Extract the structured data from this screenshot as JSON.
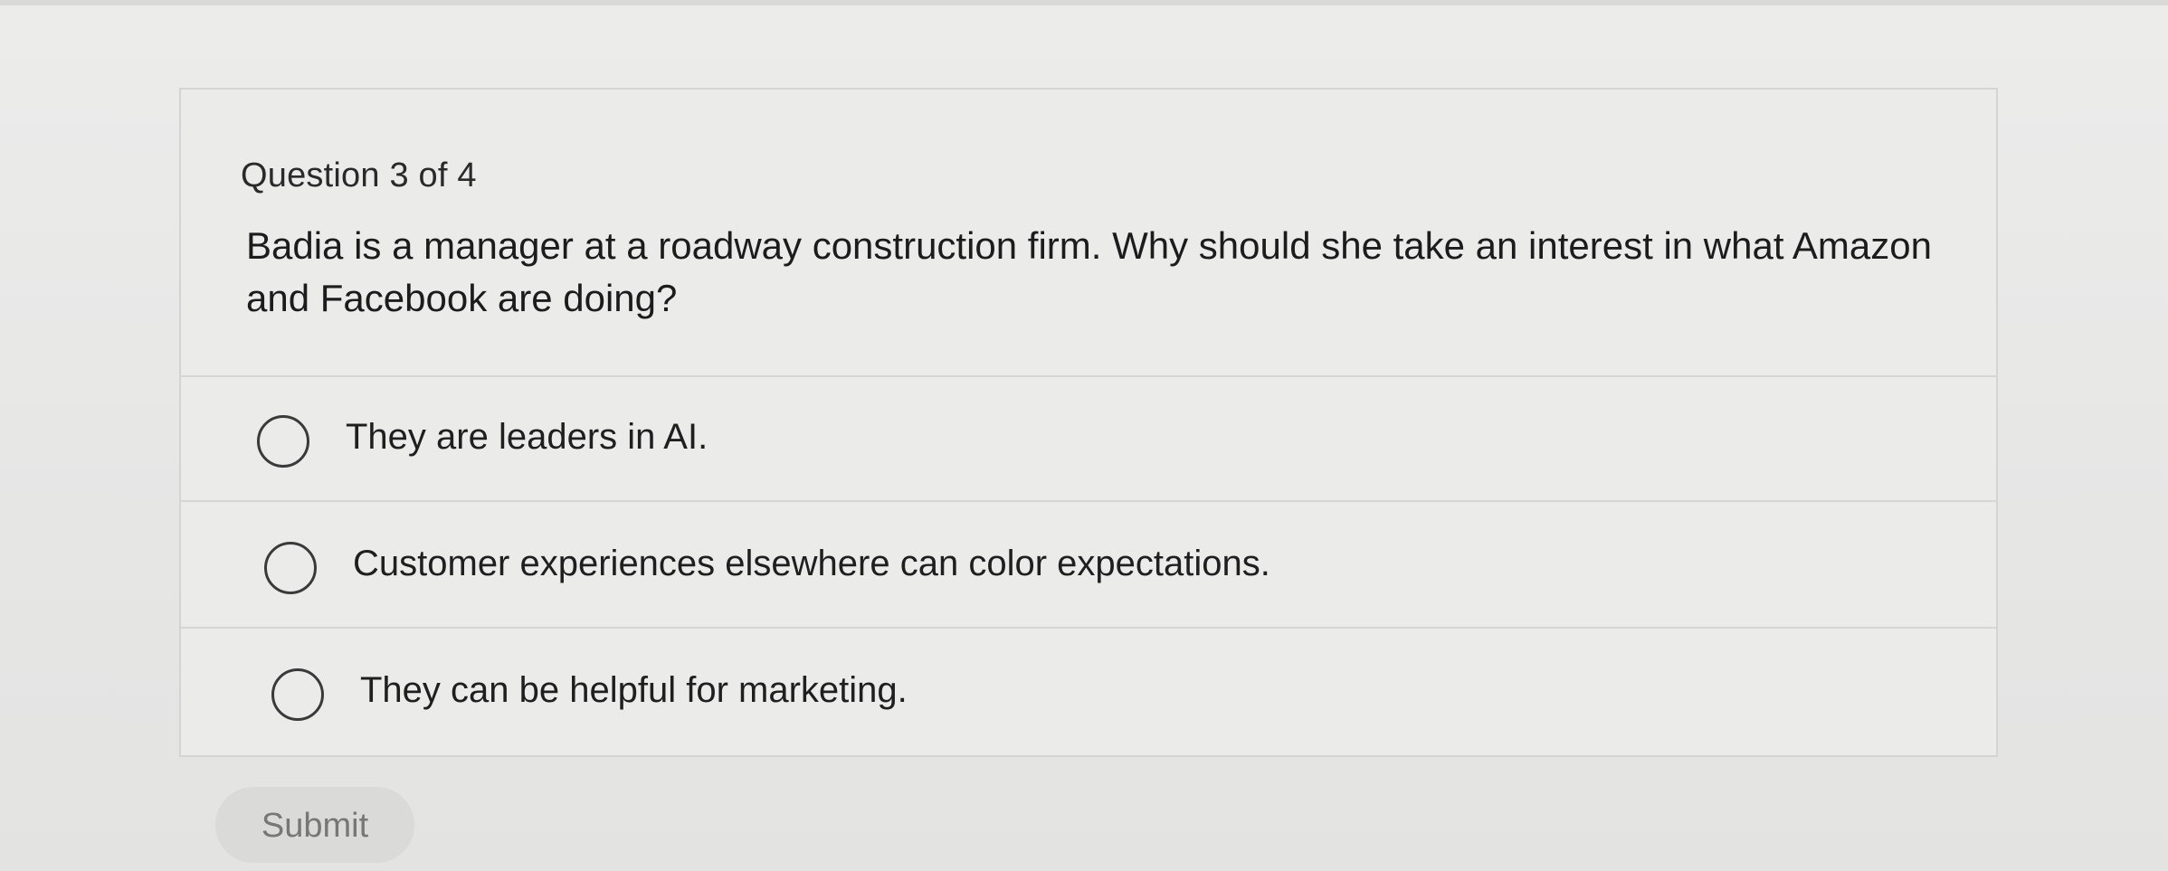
{
  "quiz": {
    "counter": "Question 3 of 4",
    "question": "Badia is a manager at a roadway construction firm. Why should she take an interest in what Amazon and Facebook are doing?",
    "options": [
      {
        "label": "They are leaders in AI.",
        "selected": false
      },
      {
        "label": "Customer experiences elsewhere can color expectations.",
        "selected": false
      },
      {
        "label": "They can be helpful for marketing.",
        "selected": false
      }
    ],
    "submit_label": "Submit",
    "submit_enabled": false
  },
  "colors": {
    "background": "#e9e9e8",
    "border": "#d4d4d3",
    "text": "#1f1f1f",
    "submit_bg": "#dadad9",
    "submit_text": "#777776"
  }
}
